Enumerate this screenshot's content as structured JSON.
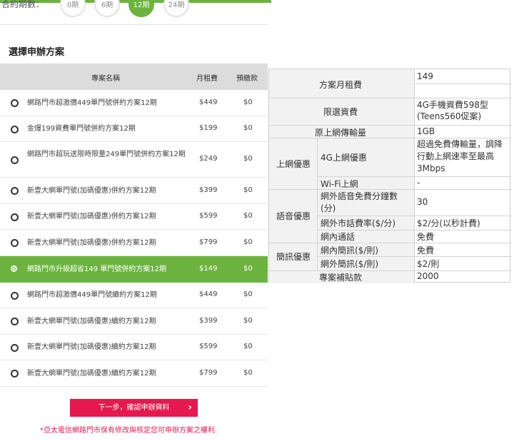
{
  "period": {
    "label": "合約期數：",
    "options": [
      "0期",
      "6期",
      "12期",
      "24期"
    ],
    "selected": "12期"
  },
  "section_title": "選擇申辦方案",
  "plans_table": {
    "headers": [
      "專案名稱",
      "月租費",
      "預繳款"
    ],
    "rows": [
      {
        "name": "網路門市超激價449單門號併約方案12期",
        "fee": "$449",
        "deposit": "$0",
        "selected": false
      },
      {
        "name": "金爆199資費單門號併約方案12期",
        "fee": "$199",
        "deposit": "$0",
        "selected": false
      },
      {
        "name": "網路門市超玩送限時限量249單門號併約方案12期",
        "fee": "$249",
        "deposit": "$0",
        "selected": false
      },
      {
        "name": "新壹大網單門號(加碼優惠)併約方案12期",
        "fee": "$399",
        "deposit": "$0",
        "selected": false
      },
      {
        "name": "新壹大網單門號(加碼優惠)併約方案12期",
        "fee": "$599",
        "deposit": "$0",
        "selected": false
      },
      {
        "name": "新壹大網單門號(加碼優惠)併約方案12期",
        "fee": "$799",
        "deposit": "$0",
        "selected": false
      },
      {
        "name": "網路門市升級超省149 單門號併約方案12期",
        "fee": "$149",
        "deposit": "$0",
        "selected": true
      },
      {
        "name": "網路門市超激價449單門號續約方案12期",
        "fee": "$449",
        "deposit": "$0",
        "selected": false
      },
      {
        "name": "新壹大網單門號(加碼優惠)續約方案12期",
        "fee": "$399",
        "deposit": "$0",
        "selected": false
      },
      {
        "name": "新壹大網單門號(加碼優惠)續約方案12期",
        "fee": "$599",
        "deposit": "$0",
        "selected": false
      },
      {
        "name": "新壹大網單門號(加碼優惠)續約方案12期",
        "fee": "$799",
        "deposit": "$0",
        "selected": false
      }
    ]
  },
  "detail": {
    "monthly_fee_label": "方案月租費",
    "monthly_fee_value": "149",
    "rate_label": "限選資費",
    "rate_value": "4G手機資費598型(Teens560促案)",
    "data_label": "原上網傳輸量",
    "data_value": "1GB",
    "internet_group": "上網優惠",
    "internet_4g_label": "4G上網優惠",
    "internet_4g_value": "超過免費傳輸量，調降行動上網速率至最高3Mbps",
    "wifi_label": "Wi-Fi上網",
    "wifi_value": "-",
    "voice_group": "語音優惠",
    "free_minutes_label": "網外語音免費分鐘數(分)",
    "free_minutes_value": "30",
    "offnet_rate_label": "網外市話費率($/分)",
    "offnet_rate_value": "$2/分(以秒計費)",
    "onnet_call_label": "網內通話",
    "onnet_call_value": "免費",
    "sms_group": "簡訊優惠",
    "onnet_sms_label": "網內簡訊($/則)",
    "onnet_sms_value": "免費",
    "offnet_sms_label": "網外簡訊($/則)",
    "offnet_sms_value": "$2/則",
    "subsidy_label": "專案補貼款",
    "subsidy_value": "2000"
  },
  "next_button": "下一步，確認申辦資料",
  "note": "*亞太電信網路門市保有修改與核定您可申辦方案之權利."
}
